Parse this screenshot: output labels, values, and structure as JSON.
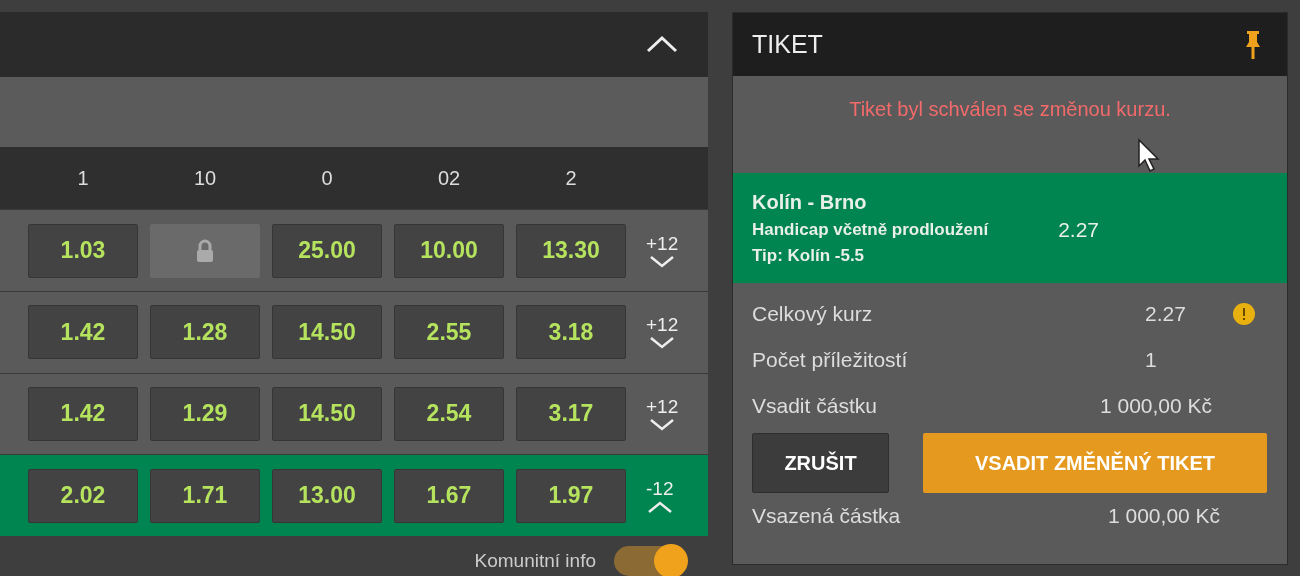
{
  "market_panel": {
    "expanded": true,
    "columns": [
      "1",
      "10",
      "0",
      "02",
      "2"
    ],
    "rows": [
      {
        "selected": false,
        "expanded": false,
        "more": "+12",
        "odds": [
          {
            "value": "1.03",
            "locked": false
          },
          {
            "locked": true
          },
          {
            "value": "25.00",
            "locked": false
          },
          {
            "value": "10.00",
            "locked": false
          },
          {
            "value": "13.30",
            "locked": false
          }
        ]
      },
      {
        "selected": false,
        "expanded": false,
        "more": "+12",
        "odds": [
          {
            "value": "1.42",
            "locked": false
          },
          {
            "value": "1.28",
            "locked": false
          },
          {
            "value": "14.50",
            "locked": false
          },
          {
            "value": "2.55",
            "locked": false
          },
          {
            "value": "3.18",
            "locked": false
          }
        ]
      },
      {
        "selected": false,
        "expanded": false,
        "more": "+12",
        "odds": [
          {
            "value": "1.42",
            "locked": false
          },
          {
            "value": "1.29",
            "locked": false
          },
          {
            "value": "14.50",
            "locked": false
          },
          {
            "value": "2.54",
            "locked": false
          },
          {
            "value": "3.17",
            "locked": false
          }
        ]
      },
      {
        "selected": true,
        "expanded": true,
        "more": "-12",
        "odds": [
          {
            "value": "2.02",
            "locked": false
          },
          {
            "value": "1.71",
            "locked": false
          },
          {
            "value": "13.00",
            "locked": false
          },
          {
            "value": "1.67",
            "locked": false
          },
          {
            "value": "1.97",
            "locked": false
          }
        ]
      }
    ],
    "community_info": {
      "label": "Komunitní info",
      "on": true
    }
  },
  "ticket": {
    "title": "TIKET",
    "pinned": true,
    "message": "Tiket byl schválen se změnou kurzu.",
    "selection": {
      "match": "Kolín - Brno",
      "market": "Handicap včetně prodloužení",
      "tip": "Tip: Kolín -5.5",
      "odd": "2.27"
    },
    "summary": [
      {
        "label": "Celkový kurz",
        "value": "2.27",
        "warning": true
      },
      {
        "label": "Počet příležitostí",
        "value": "1",
        "warning": false
      },
      {
        "label": "Vsadit částku",
        "value": "1 000,00 Kč",
        "warning": false
      }
    ],
    "buttons": {
      "cancel": "ZRUŠIT",
      "confirm": "VSADIT ZMĚNĚNÝ TIKET"
    },
    "staked": {
      "label": "Vsazená částka",
      "value": "1 000,00 Kč"
    }
  }
}
